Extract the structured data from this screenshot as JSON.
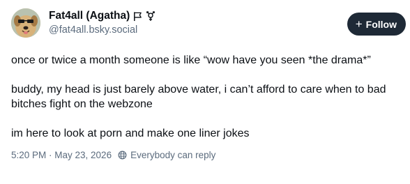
{
  "author": {
    "display_name": "Fat4all (Agatha)",
    "handle": "@fat4all.bsky.social",
    "name_icons": [
      "flag-icon",
      "transgender-symbol-icon"
    ]
  },
  "follow_button": {
    "icon": "plus-icon",
    "label": "Follow"
  },
  "post": {
    "paragraphs": [
      "once or twice a month someone is like “wow have you seen *the drama*”",
      "buddy, my head is just barely above water, i can’t afford to care when to bad bitches fight on the webzone",
      "im here to look at porn and make one liner jokes"
    ],
    "timestamp": "5:20 PM · May 23, 2026",
    "reply_setting_icon": "globe-icon",
    "reply_setting": "Everybody can reply"
  },
  "colors": {
    "text": "#0b0f14",
    "muted": "#5b6b7d",
    "button_bg": "#1e2936"
  }
}
